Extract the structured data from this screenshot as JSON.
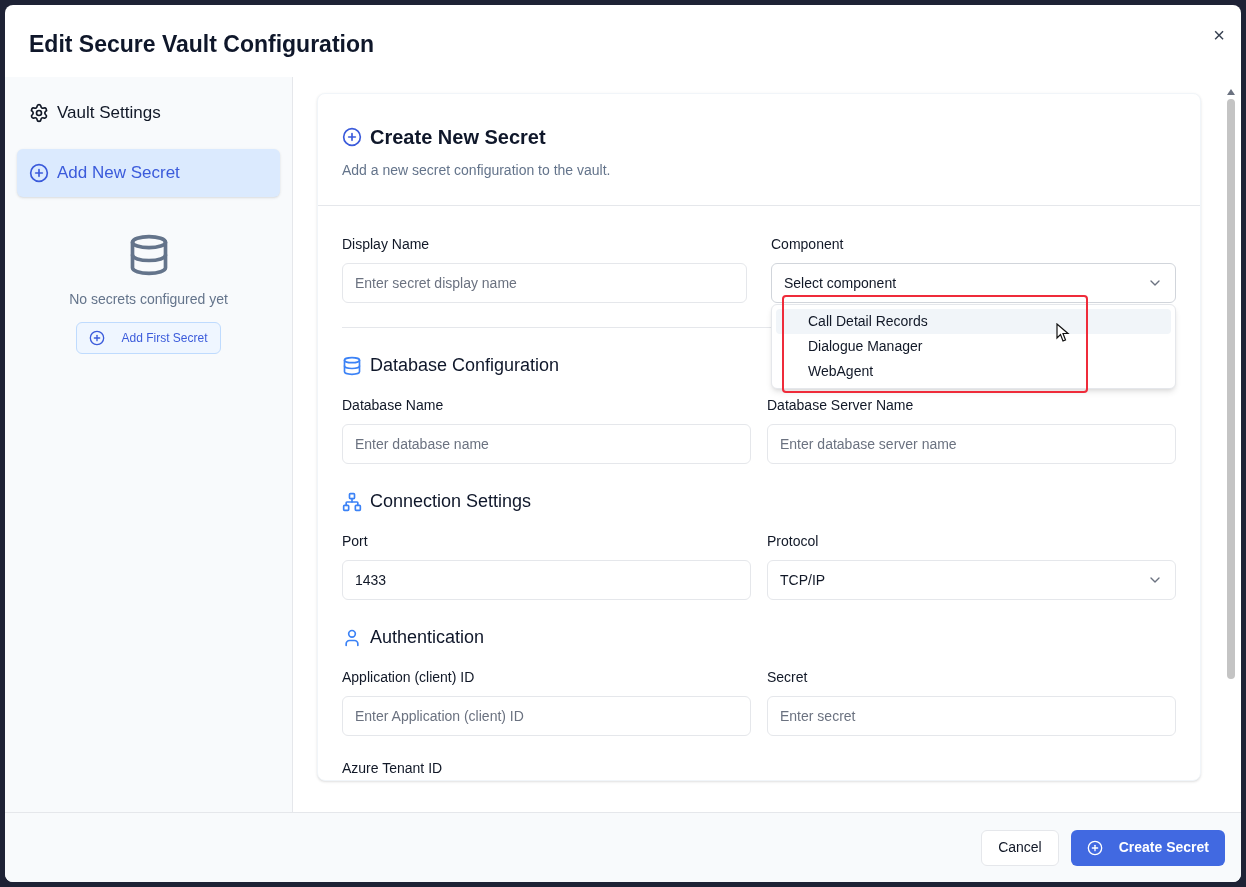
{
  "dialog": {
    "title": "Edit Secure Vault Configuration",
    "close": "×"
  },
  "sidebar": {
    "items": [
      {
        "label": "Vault Settings",
        "selected": false
      },
      {
        "label": "Add New Secret",
        "selected": true
      }
    ],
    "empty_text": "No secrets configured yet",
    "empty_button": "Add First Secret"
  },
  "card": {
    "title": "Create New Secret",
    "subtitle": "Add a new secret configuration to the vault.",
    "top_fields": [
      {
        "label": "Display Name",
        "kind": "input",
        "placeholder": "Enter secret display name"
      },
      {
        "label": "Component",
        "kind": "select",
        "value": "Select component",
        "open": true,
        "options": [
          {
            "label": "Call Detail Records",
            "selected": true
          },
          {
            "label": "Dialogue Manager",
            "selected": false
          },
          {
            "label": "WebAgent",
            "selected": false
          }
        ]
      }
    ],
    "sections": [
      {
        "title": "Database Configuration",
        "fields": [
          {
            "label": "Database Name",
            "kind": "input",
            "placeholder": "Enter database name"
          },
          {
            "label": "Database Server Name",
            "kind": "input",
            "placeholder": "Enter database server name"
          }
        ]
      },
      {
        "title": "Connection Settings",
        "fields": [
          {
            "label": "Port",
            "kind": "input",
            "value": "1433"
          },
          {
            "label": "Protocol",
            "kind": "select",
            "value": "TCP/IP",
            "open": false
          }
        ]
      },
      {
        "title": "Authentication",
        "fields": [
          {
            "label": "Application (client) ID",
            "kind": "input",
            "placeholder": "Enter Application (client) ID"
          },
          {
            "label": "Secret",
            "kind": "input",
            "placeholder": "Enter secret"
          }
        ]
      }
    ],
    "trailing_label": "Azure Tenant ID"
  },
  "footer": {
    "buttons": [
      {
        "label": "Cancel",
        "kind": "secondary"
      },
      {
        "label": "Create Secret",
        "kind": "primary"
      }
    ]
  }
}
